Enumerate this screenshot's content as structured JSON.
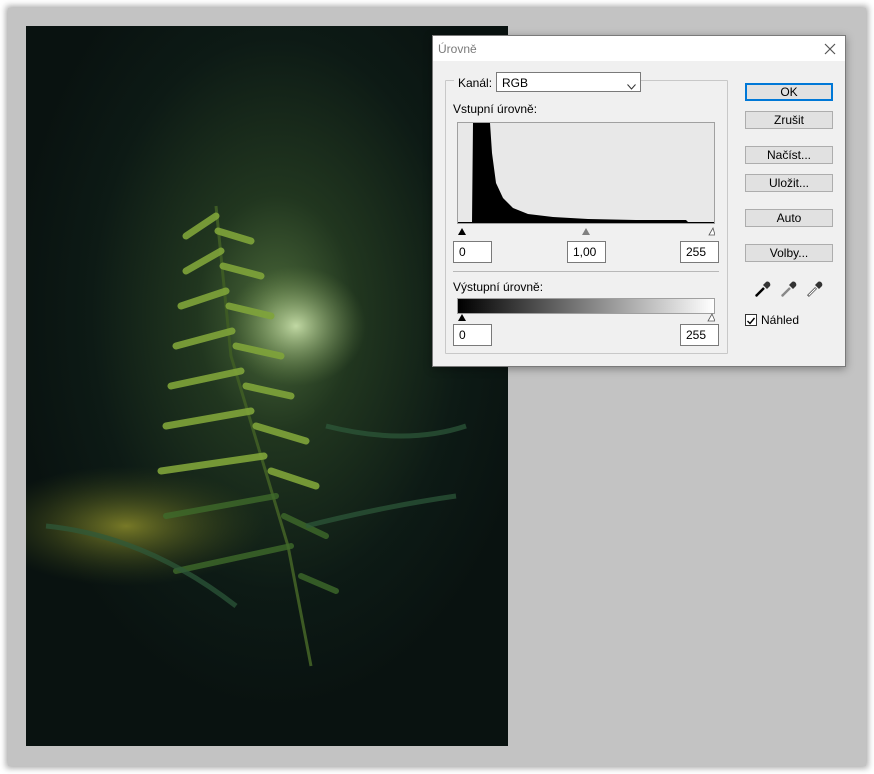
{
  "dialog": {
    "title": "Úrovně",
    "channel_label": "Kanál:",
    "channel_value": "RGB",
    "input_levels_label": "Vstupní úrovně:",
    "input_black": "0",
    "input_gamma": "1,00",
    "input_white": "255",
    "output_levels_label": "Výstupní úrovně:",
    "output_black": "0",
    "output_white": "255",
    "preview_label": "Náhled",
    "preview_checked": true
  },
  "buttons": {
    "ok": "OK",
    "cancel": "Zrušit",
    "load": "Načíst...",
    "save": "Uložit...",
    "auto": "Auto",
    "options": "Volby..."
  },
  "icons": {
    "close": "close-icon",
    "dropdown": "chevron-down-icon",
    "black_eyedropper": "eyedropper-black-icon",
    "gray_eyedropper": "eyedropper-gray-icon",
    "white_eyedropper": "eyedropper-white-icon",
    "checkmark": "checkmark-icon"
  },
  "colors": {
    "default_button_border": "#0078d7",
    "workspace": "#c3c3c3"
  }
}
